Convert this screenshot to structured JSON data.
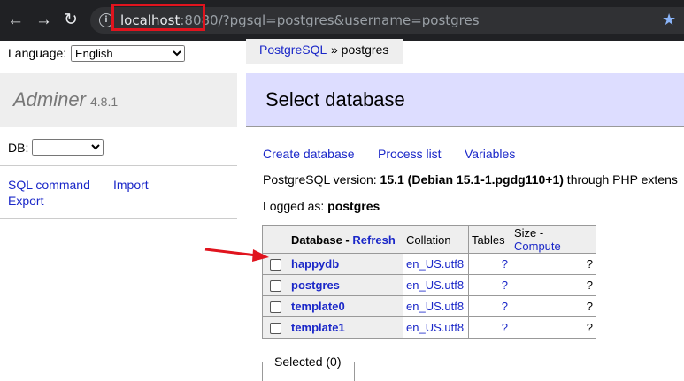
{
  "browser": {
    "url_host": "localhost",
    "url_port": ":8080",
    "url_rest": "/?pgsql=postgres&username=postgres"
  },
  "sidebar": {
    "language_label": "Language:",
    "language_value": "English",
    "app_name": "Adminer",
    "app_version": "4.8.1",
    "db_label": "DB:",
    "links": {
      "sql_command": "SQL command",
      "import": "Import",
      "export": "Export"
    }
  },
  "breadcrumb": {
    "driver": "PostgreSQL",
    "sep_server": "» postgres"
  },
  "main": {
    "title": "Select database",
    "actions": {
      "create_database": "Create database",
      "process_list": "Process list",
      "variables": "Variables"
    },
    "version_prefix": "PostgreSQL version: ",
    "version_value": "15.1 (Debian 15.1-1.pgdg110+1)",
    "version_suffix": " through PHP extens",
    "logged_prefix": "Logged as: ",
    "logged_user": "postgres",
    "table": {
      "headers": {
        "database": "Database",
        "sep": " - ",
        "refresh": "Refresh",
        "collation": "Collation",
        "tables": "Tables",
        "size": "Size",
        "size_sep": " - ",
        "compute": "Compute"
      },
      "rows": [
        {
          "name": "happydb",
          "collation": "en_US.utf8",
          "tables": "?",
          "size": "?"
        },
        {
          "name": "postgres",
          "collation": "en_US.utf8",
          "tables": "?",
          "size": "?"
        },
        {
          "name": "template0",
          "collation": "en_US.utf8",
          "tables": "?",
          "size": "?"
        },
        {
          "name": "template1",
          "collation": "en_US.utf8",
          "tables": "?",
          "size": "?"
        }
      ]
    },
    "selected_legend": "Selected (0)"
  },
  "colors": {
    "annotation_red": "#e0141e",
    "link_blue": "#1a27c8",
    "heading_bg": "#ddddff"
  }
}
